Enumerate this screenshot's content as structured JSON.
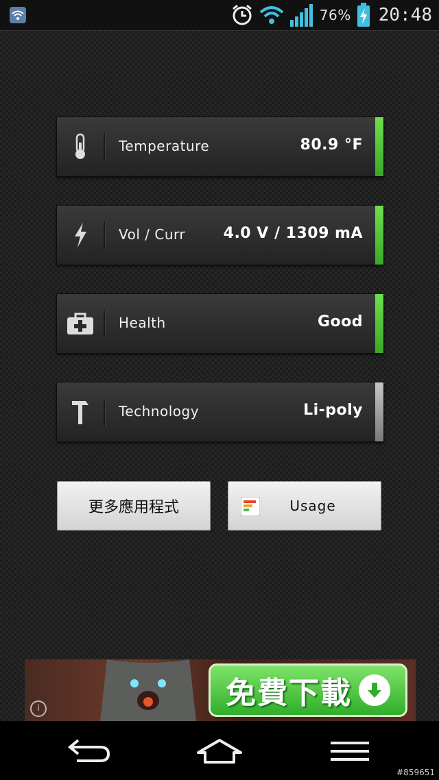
{
  "status_bar": {
    "notification_icon": "wifi-notification-icon",
    "icons": [
      "alarm-icon",
      "wifi-icon",
      "signal-icon",
      "battery-charging-icon"
    ],
    "battery_percent": "76%",
    "time": "20:48"
  },
  "cards": [
    {
      "icon": "thermometer-icon",
      "label": "Temperature",
      "value": "80.9 °F",
      "indicator_color": "#4cc534"
    },
    {
      "icon": "lightning-icon",
      "label": "Vol / Curr",
      "value": "4.0 V / 1309 mA",
      "indicator_color": "#4cc534"
    },
    {
      "icon": "first-aid-kit-icon",
      "label": "Health",
      "value": "Good",
      "indicator_color": "#4cc534"
    },
    {
      "icon": "hammer-icon",
      "label": "Technology",
      "value": "Li-poly",
      "indicator_color": "#9a9a9a"
    }
  ],
  "buttons": {
    "more_apps": "更多應用程式",
    "usage": "Usage"
  },
  "ad": {
    "download_label": "免費下載",
    "info_label": "i"
  },
  "nav_bar": {
    "icons": [
      "back-icon",
      "home-icon",
      "menu-icon"
    ]
  },
  "watermark": "#859651"
}
